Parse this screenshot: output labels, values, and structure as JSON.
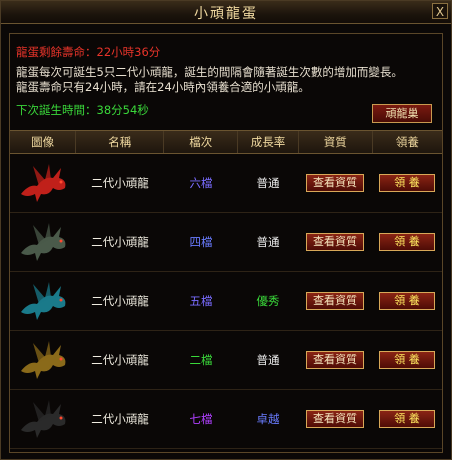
{
  "window": {
    "title": "小頑龍蛋",
    "close_label": "X"
  },
  "info": {
    "life": "龍蛋剩餘壽命：22小時36分",
    "desc1": "龍蛋每次可誕生5只二代小頑龍，誕生的間隔會隨著誕生次數的增加而變長。",
    "desc2": "龍蛋壽命只有24小時，請在24小時內領養合適的小頑龍。",
    "next": "下次誕生時間：38分54秒",
    "nest_button": "頑龍巢"
  },
  "table": {
    "headers": [
      "圖像",
      "名稱",
      "檔次",
      "成長率",
      "資質",
      "領養"
    ],
    "view_label": "查看資質",
    "adopt_label": "領 養",
    "rows": [
      {
        "name": "二代小頑龍",
        "grade": "六檔",
        "grade_color": "#7a6cff",
        "growth": "普通",
        "growth_color": "#f0f0f0",
        "dragon_color": "#c0201a"
      },
      {
        "name": "二代小頑龍",
        "grade": "四檔",
        "grade_color": "#6a7cff",
        "growth": "普通",
        "growth_color": "#f0f0f0",
        "dragon_color": "#4a5a4a"
      },
      {
        "name": "二代小頑龍",
        "grade": "五檔",
        "grade_color": "#7a6cff",
        "growth": "優秀",
        "growth_color": "#3ad83a",
        "dragon_color": "#1a7a8a"
      },
      {
        "name": "二代小頑龍",
        "grade": "二檔",
        "grade_color": "#3ad83a",
        "growth": "普通",
        "growth_color": "#f0f0f0",
        "dragon_color": "#8a6a1a"
      },
      {
        "name": "二代小頑龍",
        "grade": "七檔",
        "grade_color": "#b040ff",
        "growth": "卓越",
        "growth_color": "#6a7cff",
        "dragon_color": "#2a2a2a"
      }
    ]
  }
}
